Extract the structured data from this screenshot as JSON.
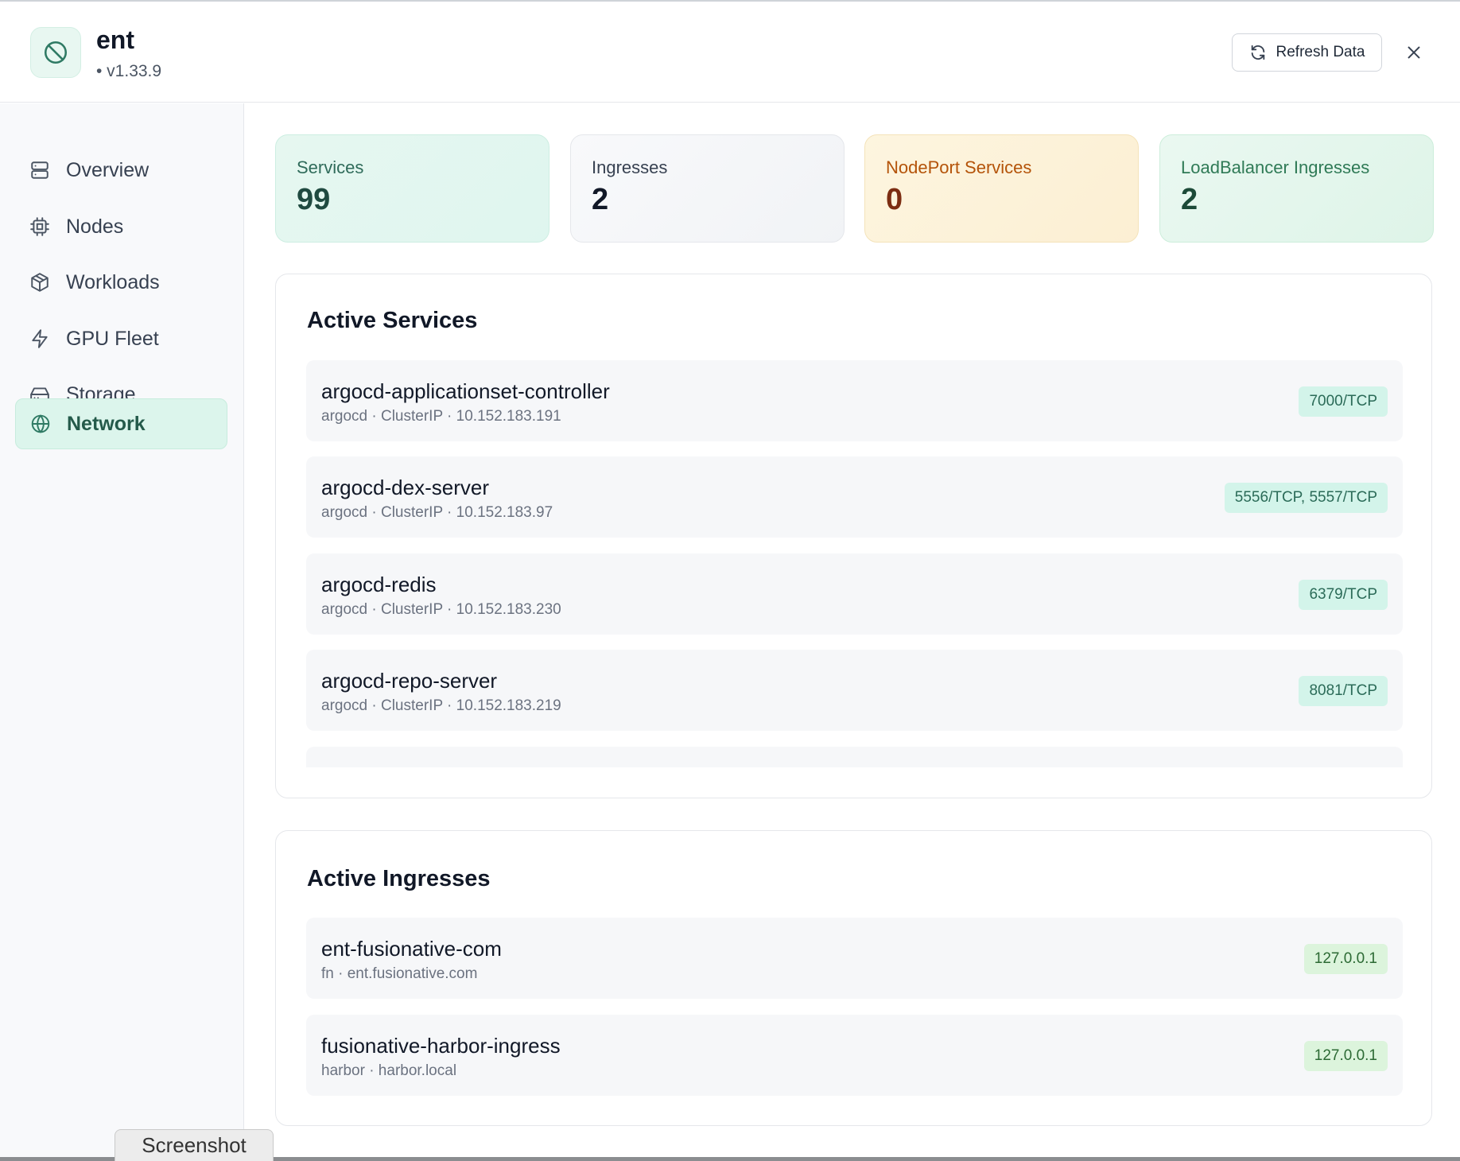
{
  "header": {
    "app_title": "ent",
    "app_version": "• v1.33.9",
    "refresh_label": "Refresh Data"
  },
  "sidebar": {
    "items": [
      {
        "label": "Overview",
        "icon": "server-icon",
        "active": false
      },
      {
        "label": "Nodes",
        "icon": "cpu-icon",
        "active": false
      },
      {
        "label": "Workloads",
        "icon": "package-icon",
        "active": false
      },
      {
        "label": "GPU Fleet",
        "icon": "zap-icon",
        "active": false
      },
      {
        "label": "Storage",
        "icon": "hard-drive-icon",
        "active": false
      },
      {
        "label": "Network",
        "icon": "globe-icon",
        "active": true
      }
    ]
  },
  "stats": [
    {
      "label": "Services",
      "value": "99"
    },
    {
      "label": "Ingresses",
      "value": "2"
    },
    {
      "label": "NodePort Services",
      "value": "0"
    },
    {
      "label": "LoadBalancer Ingresses",
      "value": "2"
    }
  ],
  "services": {
    "title": "Active Services",
    "rows": [
      {
        "name": "argocd-applicationset-controller",
        "meta": "argocd · ClusterIP · 10.152.183.191",
        "ports": "7000/TCP"
      },
      {
        "name": "argocd-dex-server",
        "meta": "argocd · ClusterIP · 10.152.183.97",
        "ports": "5556/TCP, 5557/TCP"
      },
      {
        "name": "argocd-redis",
        "meta": "argocd · ClusterIP · 10.152.183.230",
        "ports": "6379/TCP"
      },
      {
        "name": "argocd-repo-server",
        "meta": "argocd · ClusterIP · 10.152.183.219",
        "ports": "8081/TCP"
      }
    ]
  },
  "ingresses": {
    "title": "Active Ingresses",
    "rows": [
      {
        "name": "ent-fusionative-com",
        "meta": "fn · ent.fusionative.com",
        "address": "127.0.0.1"
      },
      {
        "name": "fusionative-harbor-ingress",
        "meta": "harbor · harbor.local",
        "address": "127.0.0.1"
      }
    ]
  },
  "overlay": {
    "screenshot_label": "Screenshot"
  },
  "colors": {
    "accent": "#2f7a64",
    "active_nav_bg": "#dcf5ec",
    "services_card_bg": "#e8f8f2",
    "nodeport_card_bg": "#fdf4dd",
    "nodeport_text": "#b45309",
    "loadbalancer_card_bg": "#e6f7ee"
  }
}
